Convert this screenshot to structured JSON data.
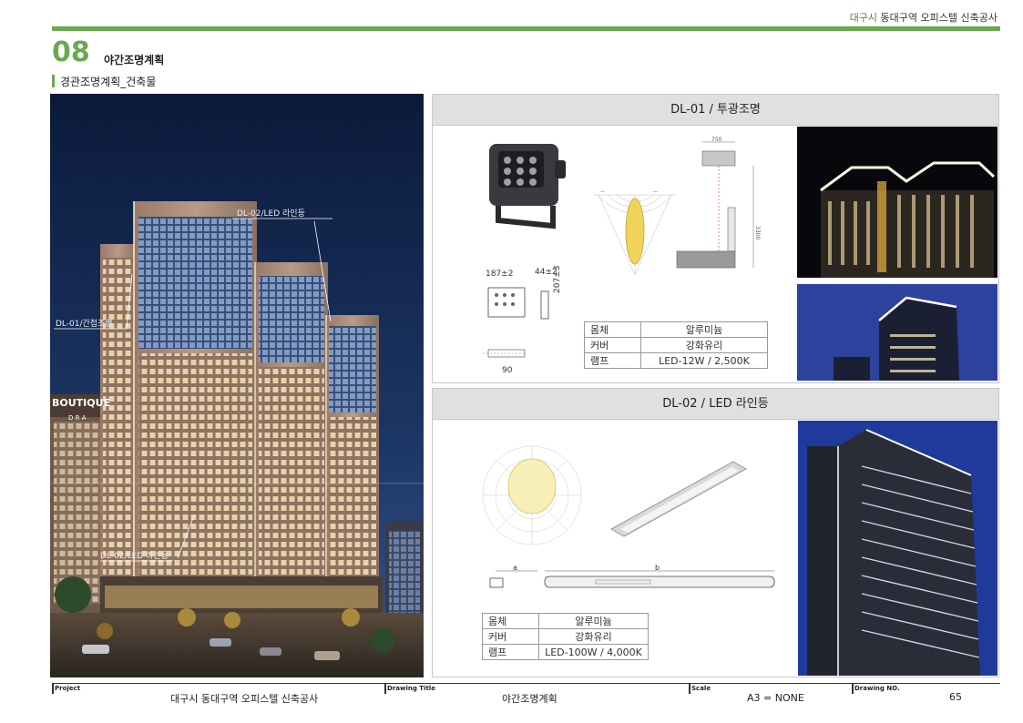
{
  "header": {
    "project_accent": "대구시",
    "project_rest": " 동대구역 오피스텔 신축공사"
  },
  "section": {
    "number": "08",
    "title": "야간조명계획",
    "subtitle": "경관조명계획_건축물"
  },
  "rendering": {
    "callouts": {
      "dl02_top": "DL-02/LED 라인등",
      "dl01_left": "DL-01/간접조명",
      "dl02_bottom": "DL-02/LED 라인등"
    },
    "sign_text": "BOUTIQUE",
    "sign_sub": "D R A"
  },
  "panel1": {
    "title": "DL-01 / 투광조명",
    "dims": {
      "width": "187±2",
      "depth": "44±2",
      "height": "207±3",
      "bottom": "90"
    },
    "section_dim_top": "750",
    "section_dim_side": "3300",
    "spec": [
      {
        "key": "몸체",
        "value": "알루미늄"
      },
      {
        "key": "커버",
        "value": "강화유리"
      },
      {
        "key": "램프",
        "value": "LED-12W / 2,500K"
      }
    ]
  },
  "panel2": {
    "title": "DL-02 / LED 라인등",
    "dims": {
      "a": "a",
      "b": "b"
    },
    "spec": [
      {
        "key": "몸체",
        "value": "알루미늄"
      },
      {
        "key": "커버",
        "value": "강화유리"
      },
      {
        "key": "램프",
        "value": "LED-100W / 4,000K"
      }
    ]
  },
  "footer": {
    "project_label": "Project",
    "project_value": "대구시 동대구역 오피스텔 신축공사",
    "drawing_title_label": "Drawing Title",
    "drawing_title_value": "야간조명계획",
    "scale_label": "Scale",
    "scale_value": "A3 = NONE",
    "drawing_no_label": "Drawing NO.",
    "drawing_no_value": "65"
  },
  "colors": {
    "accent_green": "#6aa84f",
    "panel_header_gray": "#e0e0e0",
    "night_sky": "#0d1a33"
  }
}
